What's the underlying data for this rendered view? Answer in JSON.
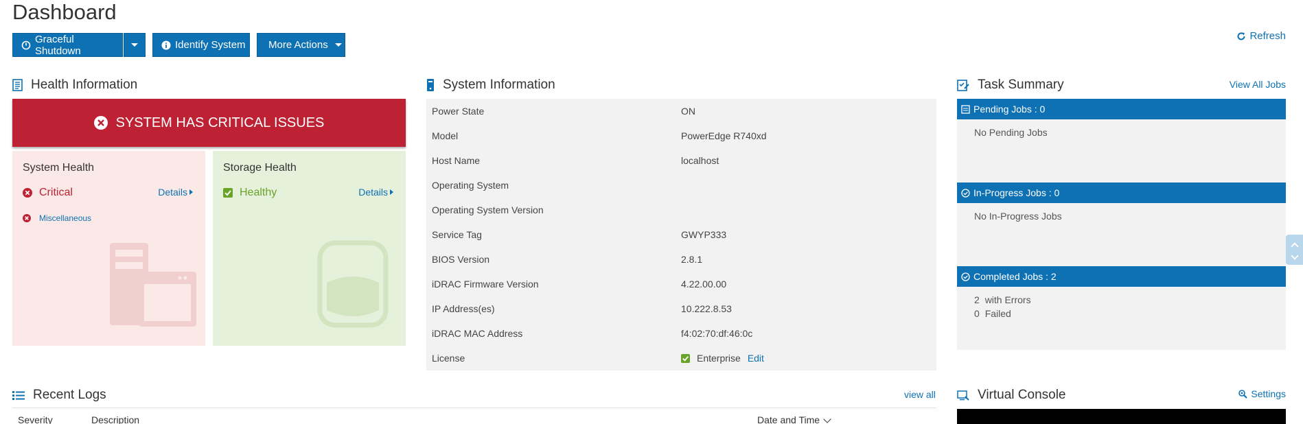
{
  "page": {
    "title": "Dashboard"
  },
  "toolbar": {
    "graceful_shutdown": "Graceful Shutdown",
    "identify_system": "Identify System",
    "more_actions": "More Actions",
    "refresh": "Refresh"
  },
  "health": {
    "title": "Health Information",
    "banner": "SYSTEM HAS CRITICAL ISSUES",
    "system": {
      "title": "System Health",
      "status": "Critical",
      "details": "Details",
      "item": "Miscellaneous"
    },
    "storage": {
      "title": "Storage Health",
      "status": "Healthy",
      "details": "Details"
    }
  },
  "sysinfo": {
    "title": "System Information",
    "rows": [
      {
        "label": "Power State",
        "value": "ON"
      },
      {
        "label": "Model",
        "value": "PowerEdge R740xd"
      },
      {
        "label": "Host Name",
        "value": "localhost"
      },
      {
        "label": "Operating System",
        "value": ""
      },
      {
        "label": "Operating System Version",
        "value": ""
      },
      {
        "label": "Service Tag",
        "value": "GWYP333"
      },
      {
        "label": "BIOS Version",
        "value": "2.8.1"
      },
      {
        "label": "iDRAC Firmware Version",
        "value": "4.22.00.00"
      },
      {
        "label": "IP Address(es)",
        "value": "10.222.8.53"
      },
      {
        "label": "iDRAC MAC Address",
        "value": "f4:02:70:df:46:0c"
      },
      {
        "label": "License",
        "value": "Enterprise",
        "edit": "Edit"
      }
    ]
  },
  "tasks": {
    "title": "Task Summary",
    "view_all": "View All Jobs",
    "pending": {
      "header": "Pending Jobs : 0",
      "text": "No Pending Jobs"
    },
    "in_progress": {
      "header": "In-Progress Jobs : 0",
      "text": "No In-Progress Jobs"
    },
    "completed": {
      "header": "Completed Jobs : 2",
      "errors_count": "2",
      "errors_label": "with Errors",
      "failed_count": "0",
      "failed_label": "Failed"
    }
  },
  "logs": {
    "title": "Recent Logs",
    "view_all": "view all",
    "columns": {
      "severity": "Severity",
      "description": "Description",
      "datetime": "Date and Time"
    }
  },
  "console": {
    "title": "Virtual Console",
    "settings": "Settings"
  },
  "colors": {
    "accent": "#0e71b3",
    "critical": "#be2133",
    "healthy": "#6aa32a"
  }
}
